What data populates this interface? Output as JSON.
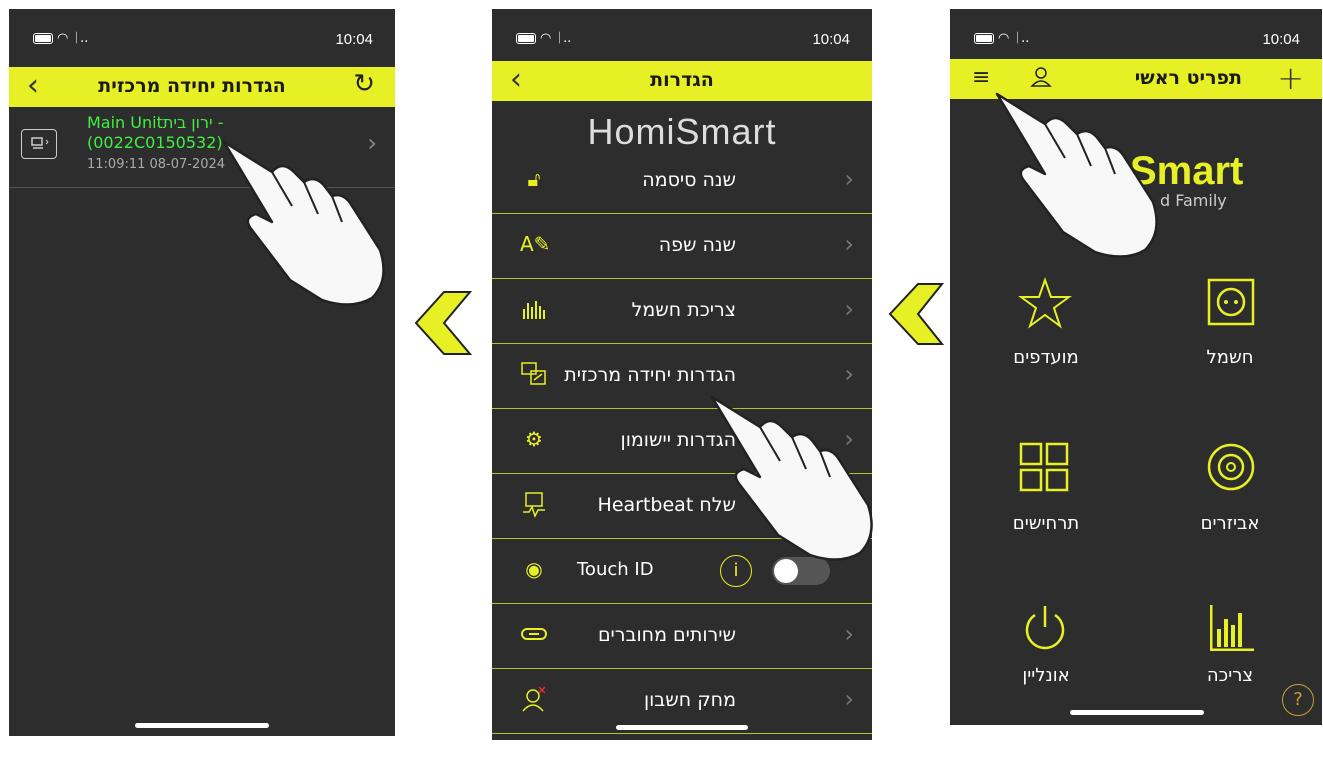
{
  "status": {
    "time": "10:04",
    "signal": "ᛁ.."
  },
  "screen_left": {
    "title": "הגדרות יחידה מרכזית",
    "unit_line1": "Main Unitירון בית -",
    "unit_line2": "(0022C0150532)",
    "unit_date": "11:09:11 08-07-2024"
  },
  "screen_mid": {
    "title": "הגדרות",
    "logo": "HomiSmart",
    "items": [
      {
        "label": "שנה סיסמה"
      },
      {
        "label": "שנה שפה"
      },
      {
        "label": "צריכת חשמל"
      },
      {
        "label": "הגדרות יחידה מרכזית"
      },
      {
        "label": "הגדרות יישומון"
      },
      {
        "label": "שלח Heartbeat"
      },
      {
        "label": "Touch ID"
      },
      {
        "label": "שירותים מחוברים"
      },
      {
        "label": "מחק חשבון"
      }
    ],
    "info_glyph": "i"
  },
  "screen_right": {
    "title": "תפריט ראשי",
    "logo_text": "Smart",
    "logo_sub": "d Family",
    "tiles": [
      {
        "label": "חשמל"
      },
      {
        "label": "מועדפים"
      },
      {
        "label": "אביזרים"
      },
      {
        "label": "תרחישים"
      },
      {
        "label": "צריכה"
      },
      {
        "label": "אונליין"
      }
    ],
    "help": "?"
  },
  "colors": {
    "accent": "#e6f025",
    "bg": "#2d2d2d",
    "green_text": "#3ff03f"
  }
}
